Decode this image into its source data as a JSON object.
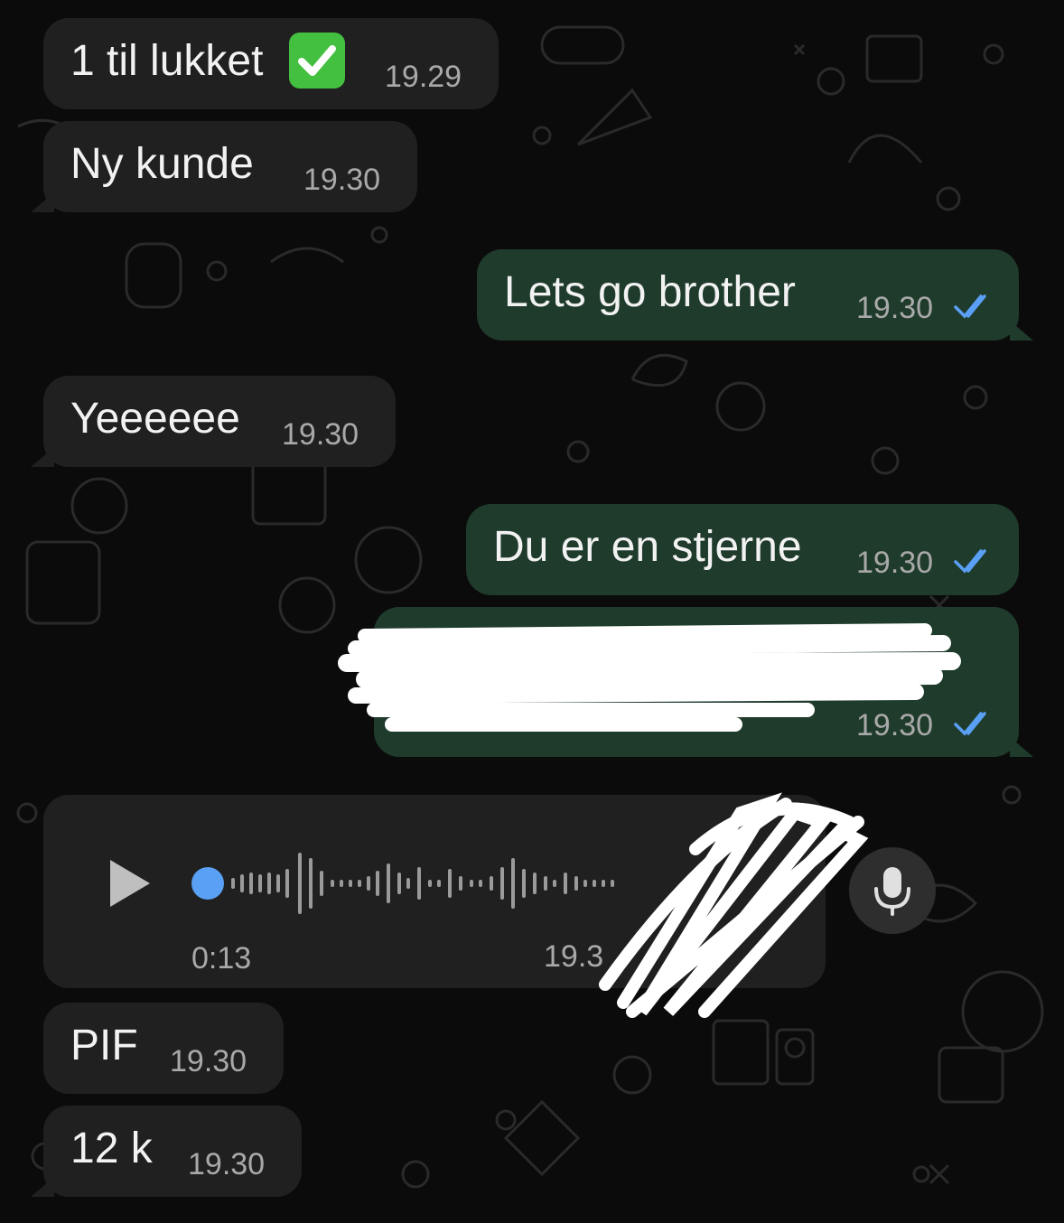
{
  "colors": {
    "incoming_bubble": "#202020",
    "outgoing_bubble": "#1f3b2c",
    "text": "#f2f2f2",
    "timestamp": "#a9a9a9",
    "read_ticks": "#5aa0f5",
    "voice_dot": "#5aa0f5"
  },
  "messages": [
    {
      "direction": "in",
      "text": "1 til lukket",
      "emoji": "check-mark-button",
      "time": "19.29"
    },
    {
      "direction": "in",
      "text": "Ny kunde",
      "time": "19.30"
    },
    {
      "direction": "out",
      "text": "Lets go brother",
      "time": "19.30",
      "status": "read"
    },
    {
      "direction": "in",
      "text": "Yeeeeee",
      "time": "19.30"
    },
    {
      "direction": "out",
      "text": "Du er en stjerne",
      "time": "19.30",
      "status": "read"
    },
    {
      "direction": "out",
      "text": "",
      "redacted": true,
      "time": "19.30",
      "status": "read"
    },
    {
      "direction": "in",
      "type": "voice",
      "duration": "0:13",
      "time": "19.3",
      "progress": 0,
      "avatar_redacted": true
    },
    {
      "direction": "in",
      "text": "PIF",
      "time": "19.30"
    },
    {
      "direction": "in",
      "text": "12 k",
      "time": "19.30"
    }
  ],
  "icons": {
    "play": "play-icon",
    "mic": "microphone-icon",
    "ticks": "double-check-icon"
  }
}
